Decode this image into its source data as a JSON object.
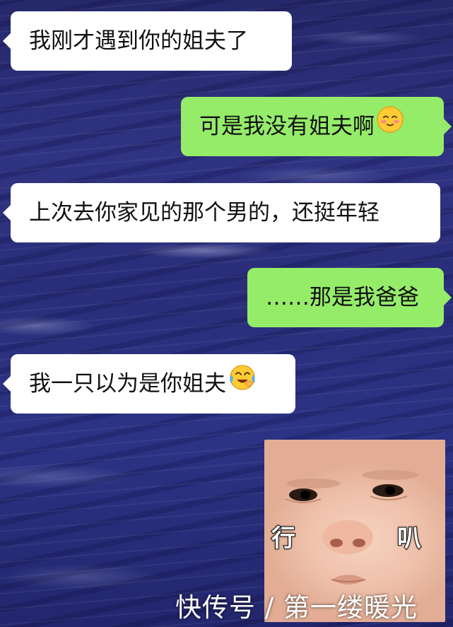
{
  "messages": [
    {
      "side": "left",
      "text": "我刚才遇到你的姐夫了"
    },
    {
      "side": "right",
      "text": "可是我没有姐夫啊",
      "emoji": "blushing-face-icon"
    },
    {
      "side": "left",
      "text": "上次去你家见的那个男的，还挺年轻"
    },
    {
      "side": "right",
      "text": "……那是我爸爸"
    },
    {
      "side": "left",
      "text": "我一只以为是你姐夫",
      "emoji": "crying-laughing-face-icon"
    }
  ],
  "sticker": {
    "left_text": "行",
    "right_text": "叭"
  },
  "watermark": "快传号 / 第一缕暖光",
  "colors": {
    "left_bubble": "#ffffff",
    "right_bubble": "#95ec69",
    "background": "#2c3385"
  }
}
